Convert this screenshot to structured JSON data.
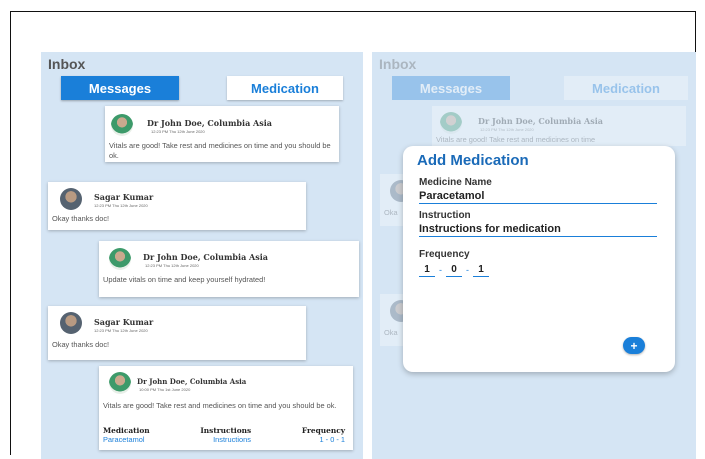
{
  "left_screen": {
    "inbox_title": "Inbox",
    "tabs": {
      "messages": "Messages",
      "medication": "Medication"
    },
    "messages": [
      {
        "sender": "Dr John Doe, Columbia Asia",
        "time": "12:23 PM Thu 12th June 2020",
        "text": "Vitals are good! Take rest and medicines on time and you should be ok."
      },
      {
        "sender": "Sagar Kumar",
        "time": "12:23 PM Thu 12th June 2020",
        "text": "Okay thanks doc!"
      },
      {
        "sender": "Dr John Doe, Columbia Asia",
        "time": "12:23 PM Thu 12th June 2020",
        "text": "Update vitals on time and keep yourself hydrated!"
      },
      {
        "sender": "Sagar Kumar",
        "time": "12:23 PM Thu 12th June 2020",
        "text": "Okay thanks doc!"
      },
      {
        "sender": "Dr John Doe, Columbia Asia",
        "time": "10:00 PM Thu 1st June 2020",
        "text": "Vitals are good! Take rest and medicines on time and you should be ok."
      }
    ],
    "medication_table": {
      "headers": [
        "Medication",
        "Instructions",
        "Frequency"
      ],
      "row": [
        "Paracetamol",
        "Instructions",
        "1 - 0 - 1"
      ]
    }
  },
  "right_screen": {
    "inbox_title": "Inbox",
    "tabs": {
      "messages": "Messages",
      "medication": "Medication"
    },
    "background_message": {
      "sender": "Dr John Doe, Columbia Asia",
      "time": "12:23 PM Thu 12th June 2020",
      "text": "Vitals are good! Take rest and medicines on time"
    },
    "background_snippets": [
      "Oka",
      "Oka"
    ],
    "dialog": {
      "title": "Add Medication",
      "medicine_name_label": "Medicine Name",
      "medicine_name_value": "Paracetamol",
      "instruction_label": "Instruction",
      "instruction_value": "Instructions for medication",
      "frequency_label": "Frequency",
      "frequency_values": [
        "1",
        "0",
        "1"
      ],
      "frequency_separator": "-",
      "add_button": "+"
    }
  },
  "colors": {
    "accent": "#1a7fd9",
    "background": "#d5e5f4",
    "title": "#1a6ab8"
  }
}
